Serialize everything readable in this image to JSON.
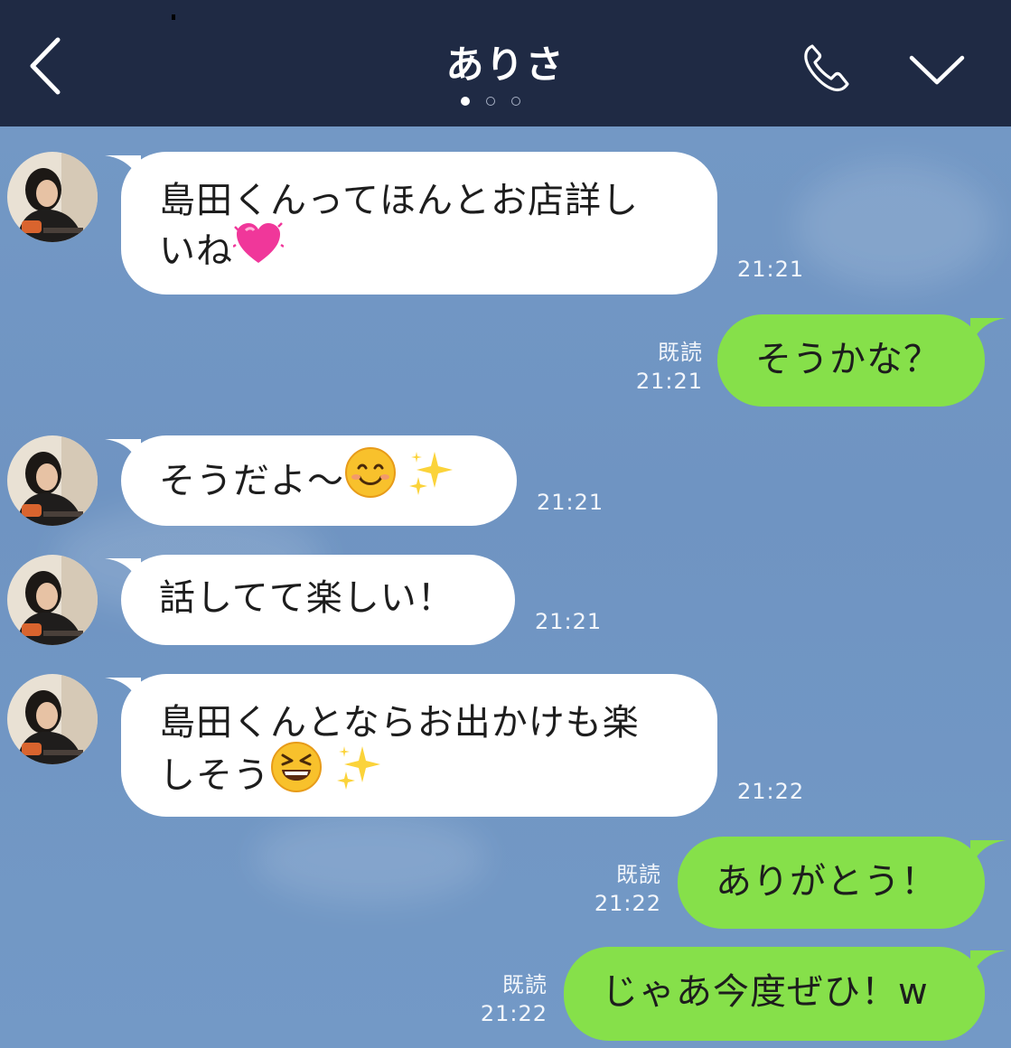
{
  "header": {
    "title": "ありさ",
    "page_count": 3,
    "active_page": 1,
    "icons": [
      "chevron-left-icon",
      "phone-icon",
      "chevron-down-icon"
    ],
    "colors": {
      "bar": "#1f2a44",
      "chat_background": "#7397c4",
      "outgoing_bubble": "#86e04a",
      "incoming_bubble": "#ffffff"
    }
  },
  "messages": [
    {
      "from": "contact",
      "line1": "島田くんってほんとお店詳し",
      "line2": "いね",
      "emoji": [
        "growing-heart-emoji"
      ],
      "time": "21:21"
    },
    {
      "from": "me",
      "text": "そうかな？",
      "read": "既読",
      "time": "21:21"
    },
    {
      "from": "contact",
      "text": "そうだよ〜",
      "emoji": [
        "smiling-face-emoji",
        "sparkles-emoji"
      ],
      "time": "21:21"
    },
    {
      "from": "contact",
      "text": "話してて楽しい！",
      "time": "21:21"
    },
    {
      "from": "contact",
      "line1": "島田くんとならお出かけも楽",
      "line2": "しそう",
      "emoji": [
        "grinning-squinting-face-emoji",
        "sparkles-emoji"
      ],
      "time": "21:22"
    },
    {
      "from": "me",
      "text": "ありがとう！",
      "read": "既読",
      "time": "21:22"
    },
    {
      "from": "me",
      "text": "じゃあ今度ぜひ！w",
      "read": "既読",
      "time": "21:22"
    }
  ]
}
